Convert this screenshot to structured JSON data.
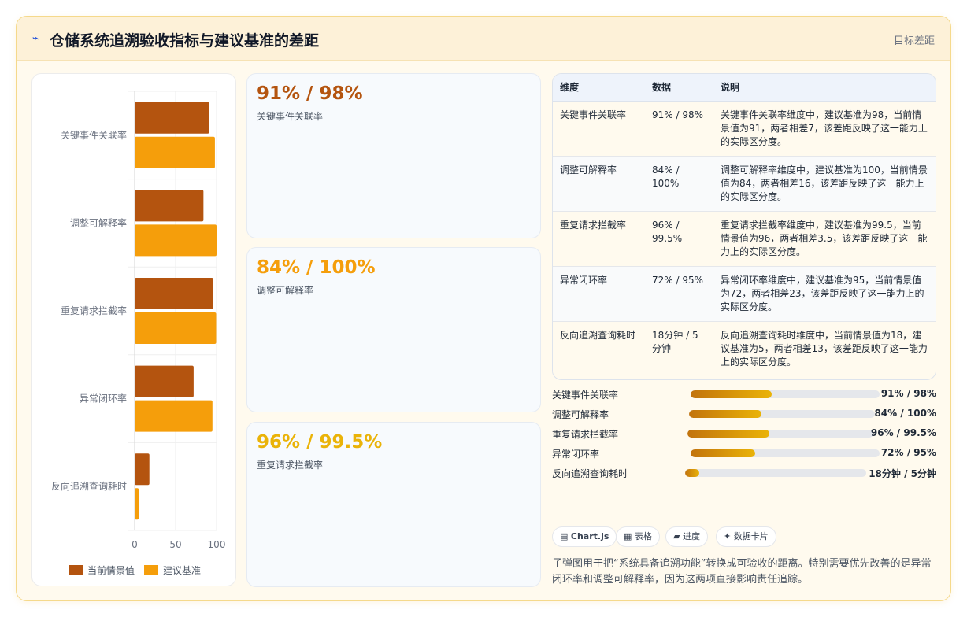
{
  "header": {
    "title": "仓储系统追溯验收指标与建议基准的差距",
    "tag": "目标差距",
    "logo_icon": "trend-line-icon"
  },
  "chart_data": {
    "type": "bar",
    "orientation": "horizontal",
    "categories": [
      "关键事件关联率",
      "调整可解释率",
      "重复请求拦截率",
      "异常闭环率",
      "反向追溯查询耗时"
    ],
    "series": [
      {
        "name": "当前情景值",
        "values": [
          91,
          84,
          96,
          72,
          18
        ],
        "color": "#b4540f"
      },
      {
        "name": "建议基准",
        "values": [
          98,
          100,
          99.5,
          95,
          5
        ],
        "color": "#f59e0b"
      }
    ],
    "xlim": [
      0,
      100
    ],
    "xticks": [
      "0",
      "50",
      "100"
    ],
    "grid": true,
    "legend": "bottom"
  },
  "kpis": [
    {
      "value": "91% / 98%",
      "label": "关键事件关联率",
      "color": "#b4540f"
    },
    {
      "value": "84% / 100%",
      "label": "调整可解释率",
      "color": "#f59e0b"
    },
    {
      "value": "96% / 99.5%",
      "label": "重复请求拦截率",
      "color": "#eab308"
    }
  ],
  "table": {
    "headers": [
      "维度",
      "数据",
      "说明"
    ],
    "rows": [
      [
        "关键事件关联率",
        "91% / 98%",
        "关键事件关联率维度中，建议基准为98，当前情景值为91，两者相差7，该差距反映了这一能力上的实际区分度。"
      ],
      [
        "调整可解释率",
        "84% / 100%",
        "调整可解释率维度中，建议基准为100，当前情景值为84，两者相差16，该差距反映了这一能力上的实际区分度。"
      ],
      [
        "重复请求拦截率",
        "96% / 99.5%",
        "重复请求拦截率维度中，建议基准为99.5，当前情景值为96，两者相差3.5，该差距反映了这一能力上的实际区分度。"
      ],
      [
        "异常闭环率",
        "72% / 95%",
        "异常闭环率维度中，建议基准为95，当前情景值为72，两者相差23，该差距反映了这一能力上的实际区分度。"
      ],
      [
        "反向追溯查询耗时",
        "18分钟 / 5分钟",
        "反向追溯查询耗时维度中，当前情景值为18，建议基准为5，两者相差13，该差距反映了这一能力上的实际区分度。"
      ]
    ]
  },
  "progress": [
    {
      "label": "关键事件关联率",
      "fraction": 0.43,
      "value": "91% / 98%"
    },
    {
      "label": "调整可解释率",
      "fraction": 0.39,
      "value": "84% / 100%"
    },
    {
      "label": "重复请求拦截率",
      "fraction": 0.44,
      "value": "96% / 99.5%"
    },
    {
      "label": "异常闭环率",
      "fraction": 0.34,
      "value": "72% / 95%"
    },
    {
      "label": "反向追溯查询耗时",
      "fraction": 0.08,
      "value": "18分钟 / 5分钟"
    }
  ],
  "pills": [
    {
      "icon": "chart-icon",
      "glyph": "▤",
      "label": "Chart.js"
    },
    {
      "icon": "table-icon",
      "glyph": "▦",
      "label": "表格"
    },
    {
      "icon": "progress-icon",
      "glyph": "▰",
      "label": "进度"
    },
    {
      "icon": "sparkle-icon",
      "glyph": "✦",
      "label": "数据卡片"
    }
  ],
  "note": "子弹图用于把“系统具备追溯功能”转换成可验收的距离。特别需要优先改善的是异常闭环率和调整可解释率，因为这两项直接影响责任追踪。"
}
